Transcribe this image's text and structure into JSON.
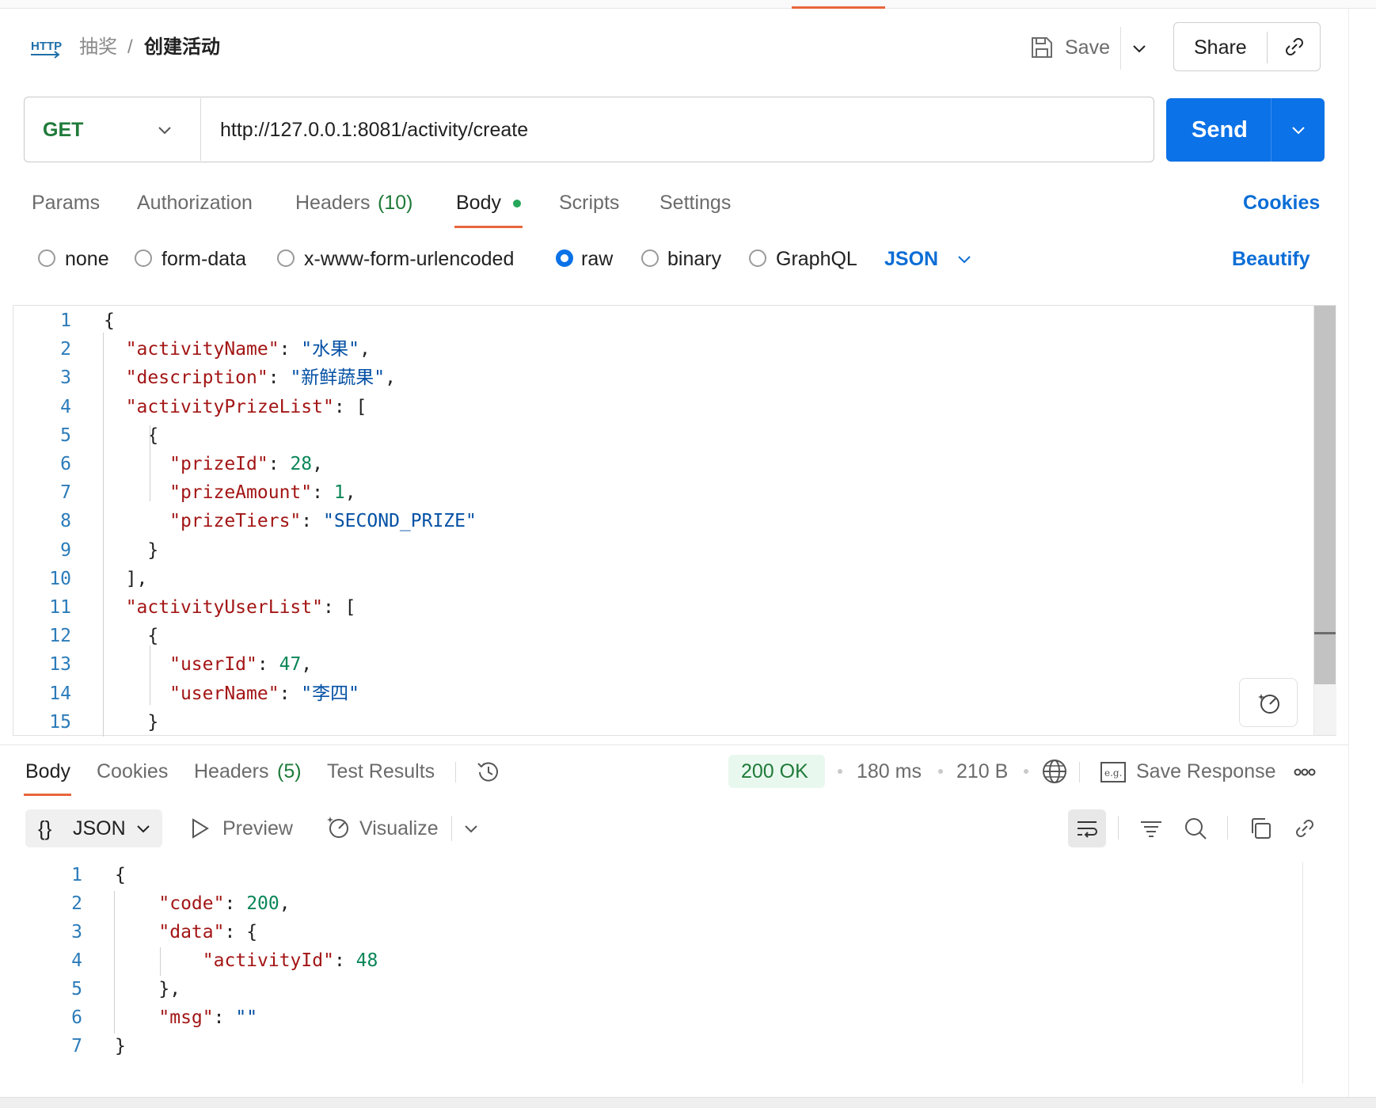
{
  "header": {
    "method_icon": "HTTP",
    "collection": "抽奖",
    "separator": "/",
    "request_title": "创建活动",
    "save_label": "Save",
    "share_label": "Share"
  },
  "request": {
    "method": "GET",
    "url": "http://127.0.0.1:8081/activity/create",
    "send_label": "Send"
  },
  "request_tabs": {
    "params": "Params",
    "authorization": "Authorization",
    "headers": "Headers",
    "headers_count": "(10)",
    "body": "Body",
    "scripts": "Scripts",
    "settings": "Settings",
    "cookies": "Cookies"
  },
  "body_types": {
    "none": "none",
    "form_data": "form-data",
    "x_www": "x-www-form-urlencoded",
    "raw": "raw",
    "binary": "binary",
    "graphql": "GraphQL",
    "selected": "raw",
    "format": "JSON",
    "beautify": "Beautify"
  },
  "request_body": {
    "line_numbers": [
      "1",
      "2",
      "3",
      "4",
      "5",
      "6",
      "7",
      "8",
      "9",
      "10",
      "11",
      "12",
      "13",
      "14",
      "15"
    ],
    "lines": [
      "{",
      "  \"activityName\": \"水果\",",
      "  \"description\": \"新鲜蔬果\",",
      "  \"activityPrizeList\": [",
      "    {",
      "      \"prizeId\": 28,",
      "      \"prizeAmount\": 1,",
      "      \"prizeTiers\": \"SECOND_PRIZE\"",
      "    }",
      "  ],",
      "  \"activityUserList\": [",
      "    {",
      "      \"userId\": 47,",
      "      \"userName\": \"李四\"",
      "    }"
    ]
  },
  "response": {
    "tabs": {
      "body": "Body",
      "cookies": "Cookies",
      "headers": "Headers",
      "headers_count": "(5)",
      "test_results": "Test Results"
    },
    "status": "200 OK",
    "time": "180 ms",
    "size": "210 B",
    "save_response": "Save Response",
    "format": "JSON",
    "format_icon": "{}",
    "preview": "Preview",
    "visualize": "Visualize",
    "line_numbers": [
      "1",
      "2",
      "3",
      "4",
      "5",
      "6",
      "7"
    ],
    "lines": [
      "{",
      "    \"code\": 200,",
      "    \"data\": {",
      "        \"activityId\": 48",
      "    },",
      "    \"msg\": \"\"",
      "}"
    ]
  },
  "colors": {
    "accent_orange": "#e8663d",
    "send_blue": "#0b72e7",
    "link_blue": "#0b6dd6",
    "method_green": "#1f7a39",
    "json_key": "#a31515",
    "json_string": "#0451a5",
    "json_number": "#098658"
  }
}
